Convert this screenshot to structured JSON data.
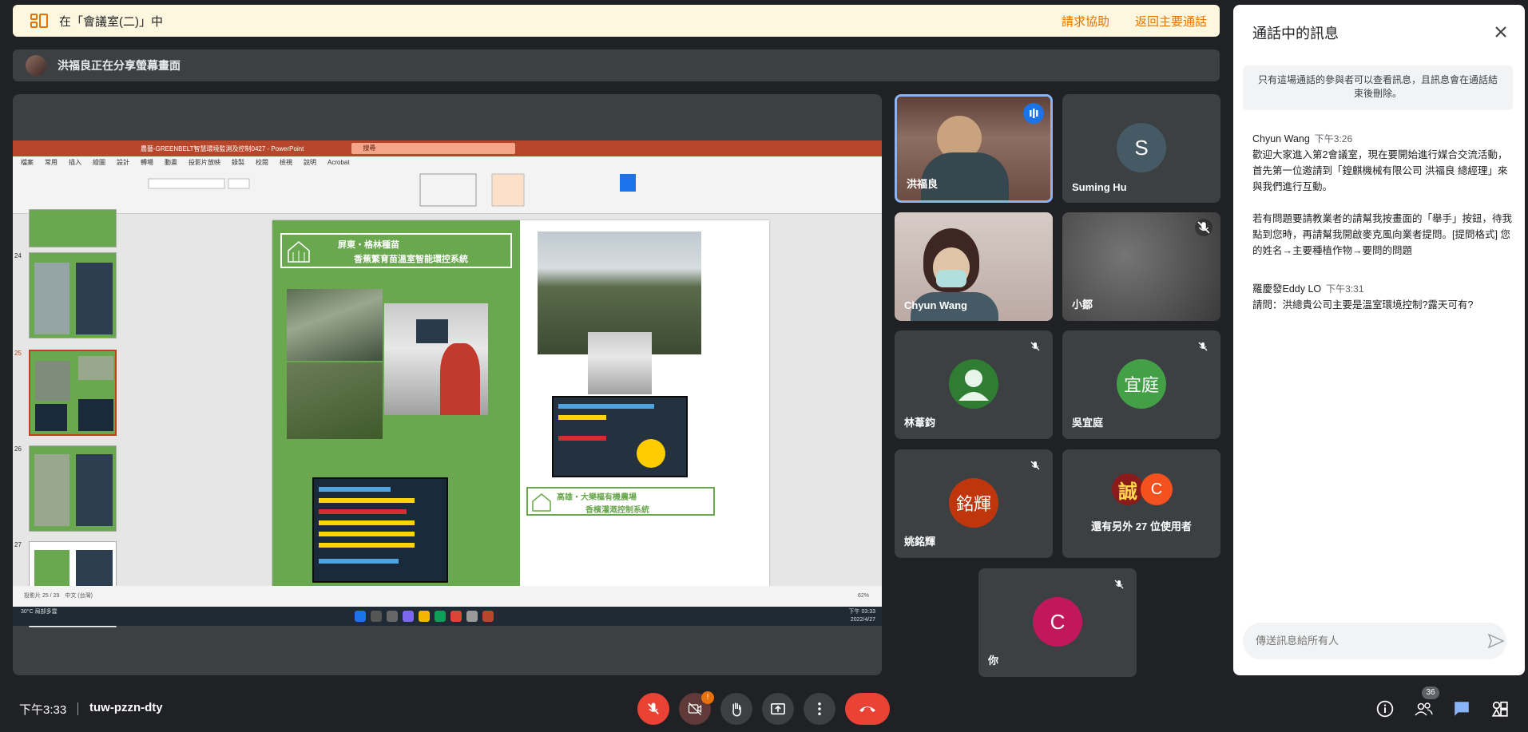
{
  "banner": {
    "location_text": "在「會議室(二)」中",
    "help_link": "請求協助",
    "return_link": "返回主要通話"
  },
  "presenting": {
    "text": "洪福良正在分享螢幕畫面"
  },
  "shared_screen": {
    "ppt_title": "農藝-GREENBELT智慧環境監測及控制0427 - PowerPoint",
    "search_text": "搜尋",
    "menu_tabs": [
      "檔案",
      "常用",
      "插入",
      "繪圖",
      "設計",
      "轉場",
      "動畫",
      "投影片放映",
      "錄製",
      "校閱",
      "檢視",
      "說明",
      "Acrobat"
    ],
    "slide_numbers": [
      "24",
      "25",
      "26",
      "27"
    ],
    "slide_left_title_1": "屏東・格林種苗",
    "slide_left_title_2": "香蕉繁育苗溫室智能環控系統",
    "slide_right_title_1": "高雄・大樂樞有機農場",
    "slide_right_title_2": "香檳灌溉控制系統",
    "status_left": "投影片 25 / 29　中文 (台灣)",
    "status_zoom": "62%",
    "weather": "30°C 局部多雲",
    "taskbar_time": "下午 03:33",
    "taskbar_date": "2022/4/27"
  },
  "participants": [
    {
      "name": "洪福良",
      "type": "video",
      "speaking": true
    },
    {
      "name": "Suming Hu",
      "initial": "S",
      "color": "#455a64",
      "muted": false
    },
    {
      "name": "Chyun Wang",
      "type": "video"
    },
    {
      "name": "小鄒",
      "type": "video",
      "muted": true
    },
    {
      "name": "林葦鈞",
      "type": "avatar-silhouette",
      "color": "#2e7d32",
      "muted": true
    },
    {
      "name": "吳宜庭",
      "initial": "宜庭",
      "color": "#43a047",
      "muted": true
    },
    {
      "name": "姚銘輝",
      "initial": "銘輝",
      "color": "#bf360c",
      "muted": true
    },
    {
      "name": "還有另外 27 位使用者",
      "initial_a": "誠",
      "initial_b": "C",
      "color_a": "#8b1a1a",
      "color_b": "#f4511e"
    },
    {
      "name": "你",
      "initial": "C",
      "color": "#c2185b",
      "muted": true
    }
  ],
  "panel": {
    "title": "通話中的訊息",
    "notice": "只有這場通話的參與者可以查看訊息，且訊息會在通話結束後刪除。",
    "messages": [
      {
        "sender": "Chyun Wang",
        "time": "下午3:26",
        "lines": [
          "歡迎大家進入第2會議室，現在要開始進行媒合交流活動，首先第一位邀請到「鍠麒機械有限公司 洪福良 總經理」來與我們進行互動。",
          "若有問題要請教業者的請幫我按畫面的「舉手」按鈕，待我點到您時，再請幫我開啟麥克風向業者提問。[提問格式] 您的姓名→主要種植作物→要問的問題"
        ]
      },
      {
        "sender": "羅慶發Eddy LO",
        "time": "下午3:31",
        "lines": [
          "請問：洪總貴公司主要是溫室環境控制?露天可有?"
        ]
      }
    ],
    "input_placeholder": "傳送訊息給所有人"
  },
  "bottom": {
    "clock": "下午3:33",
    "meeting_code": "tuw-pzzn-dty",
    "camera_badge": "!",
    "people_count": "36"
  },
  "colors": {
    "accent_orange": "#e37400",
    "danger_red": "#ea4335",
    "chat_blue": "#8ab4f8"
  }
}
